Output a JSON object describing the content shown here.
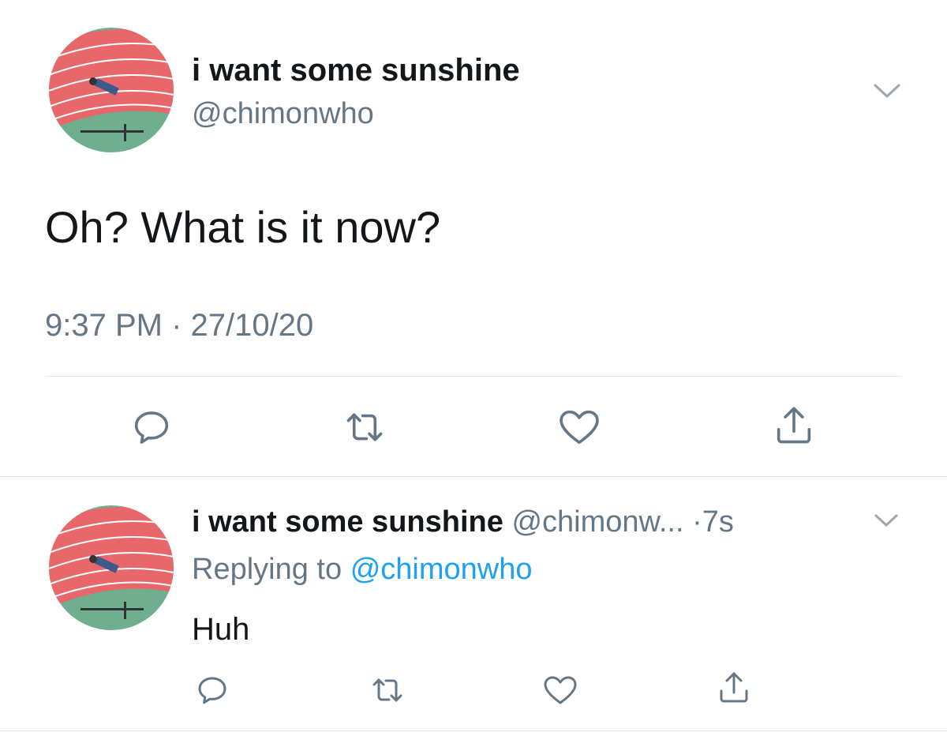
{
  "main_tweet": {
    "display_name": "i want some sunshine",
    "handle": "@chimonwho",
    "text": "Oh? What is it now?",
    "timestamp": "9:37 PM · 27/10/20",
    "actions": [
      "reply-icon",
      "retweet-icon",
      "like-icon",
      "share-icon"
    ]
  },
  "reply_tweet": {
    "display_name": "i want some sunshine",
    "handle": "@chimonw...",
    "age": "·7s",
    "replying_prefix": "Replying to",
    "replying_handle": "@chimonwho",
    "text": "Huh",
    "actions": [
      "reply-icon",
      "retweet-icon",
      "like-icon",
      "share-icon"
    ]
  },
  "colors": {
    "icon_gray": "#657786",
    "link_blue": "#1da1f2",
    "divider": "#e1e8ed"
  }
}
